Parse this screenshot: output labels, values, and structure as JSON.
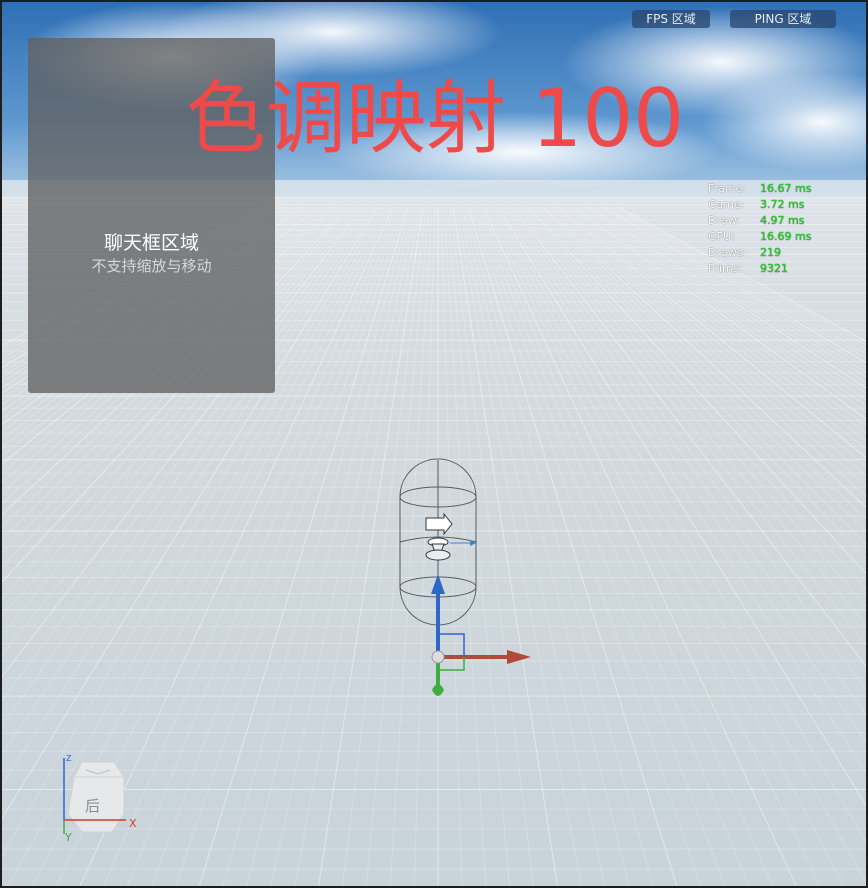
{
  "overlay": {
    "fps_button": "FPS 区域",
    "ping_button": "PING 区域",
    "tone_mapping_label": "色调映射 100"
  },
  "chat_panel": {
    "title": "聊天框区域",
    "subtitle": "不支持缩放与移动"
  },
  "stats": [
    {
      "key": "Frame:",
      "value": "16.67 ms"
    },
    {
      "key": "Game:",
      "value": "3.72 ms"
    },
    {
      "key": "Draw:",
      "value": "4.97 ms"
    },
    {
      "key": "GPU:",
      "value": "16.69 ms"
    },
    {
      "key": "Draws:",
      "value": "219"
    },
    {
      "key": "Prims:",
      "value": "9321"
    }
  ],
  "view_gizmo": {
    "face_label": "后",
    "axis_x": "X",
    "axis_y": "Y",
    "axis_z": "Z"
  },
  "colors": {
    "tone_text": "#ef4a4a",
    "stat_value": "#1fd21f",
    "axis_x": "#d23b2b",
    "axis_y": "#3fae3f",
    "axis_z": "#2e67c8"
  }
}
